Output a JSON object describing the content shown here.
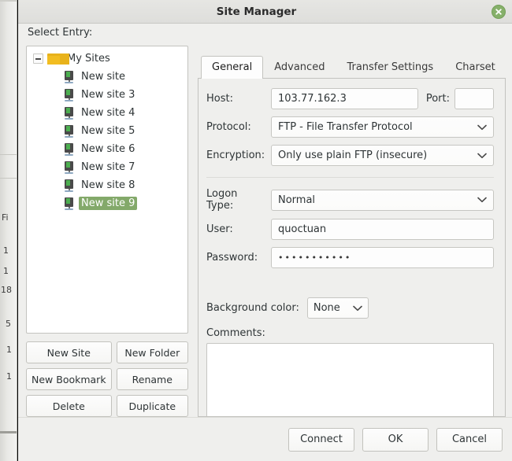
{
  "window": {
    "title": "Site Manager",
    "close_icon": "close-circle-icon"
  },
  "background_window": {
    "fragments": [
      "Fi",
      "1",
      "1",
      "18",
      "5",
      "1",
      "1"
    ]
  },
  "sidebar": {
    "label": "Select Entry:",
    "tree": {
      "root": {
        "label": "My Sites",
        "icon": "folder-icon",
        "expander": "collapse-minus-icon",
        "expanded": true
      },
      "children": [
        {
          "label": "New site",
          "icon": "server-icon",
          "selected": false
        },
        {
          "label": "New site 3",
          "icon": "server-icon",
          "selected": false
        },
        {
          "label": "New site 4",
          "icon": "server-icon",
          "selected": false
        },
        {
          "label": "New site 5",
          "icon": "server-icon",
          "selected": false
        },
        {
          "label": "New site 6",
          "icon": "server-icon",
          "selected": false
        },
        {
          "label": "New site 7",
          "icon": "server-icon",
          "selected": false
        },
        {
          "label": "New site 8",
          "icon": "server-icon",
          "selected": false
        },
        {
          "label": "New site 9",
          "icon": "server-icon",
          "selected": true
        }
      ]
    },
    "buttons": [
      {
        "label": "New Site"
      },
      {
        "label": "New Folder"
      },
      {
        "label": "New Bookmark"
      },
      {
        "label": "Rename"
      },
      {
        "label": "Delete"
      },
      {
        "label": "Duplicate"
      }
    ]
  },
  "tabs": [
    {
      "label": "General",
      "active": true
    },
    {
      "label": "Advanced",
      "active": false
    },
    {
      "label": "Transfer Settings",
      "active": false
    },
    {
      "label": "Charset",
      "active": false
    }
  ],
  "general": {
    "host": {
      "label": "Host:",
      "value": "103.77.162.3",
      "placeholder": ""
    },
    "port": {
      "label": "Port:",
      "value": "",
      "placeholder": ""
    },
    "protocol": {
      "label": "Protocol:",
      "value": "FTP - File Transfer Protocol"
    },
    "encryption": {
      "label": "Encryption:",
      "value": "Only use plain FTP (insecure)"
    },
    "logon_type": {
      "label": "Logon Type:",
      "value": "Normal"
    },
    "user": {
      "label": "User:",
      "value": "quoctuan",
      "placeholder": ""
    },
    "password": {
      "label": "Password:",
      "value": "•••••••••••"
    },
    "background_color": {
      "label": "Background color:",
      "value": "None"
    },
    "comments": {
      "label": "Comments:",
      "value": "",
      "placeholder": ""
    }
  },
  "footer": {
    "connect_label": "Connect",
    "ok_label": "OK",
    "cancel_label": "Cancel"
  },
  "colors": {
    "selection_green": "#83a96a",
    "close_green": "#86b06a",
    "folder_yellow": "#f2bd21",
    "dialog_bg": "#efefed"
  }
}
